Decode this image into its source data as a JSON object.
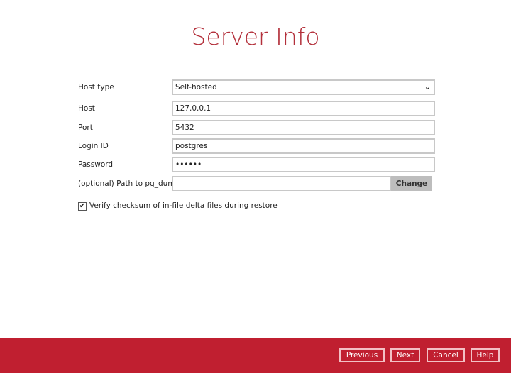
{
  "title": "Server Info",
  "fields": {
    "host_type_label": "Host type",
    "host_type_value": "Self-hosted",
    "host_label": "Host",
    "host_value": "127.0.0.1",
    "port_label": "Port",
    "port_value": "5432",
    "login_label": "Login ID",
    "login_value": "postgres",
    "password_label": "Password",
    "password_value": "••••••",
    "path_label": "(optional) Path to pg_dump",
    "path_value": "",
    "change_label": "Change"
  },
  "checkbox": {
    "label": "Verify checksum of in-file delta files during restore",
    "checked": true,
    "mark": "✔"
  },
  "footer": {
    "previous": "Previous",
    "next": "Next",
    "cancel": "Cancel",
    "help": "Help"
  },
  "colors": {
    "accent": "#c01f30"
  }
}
